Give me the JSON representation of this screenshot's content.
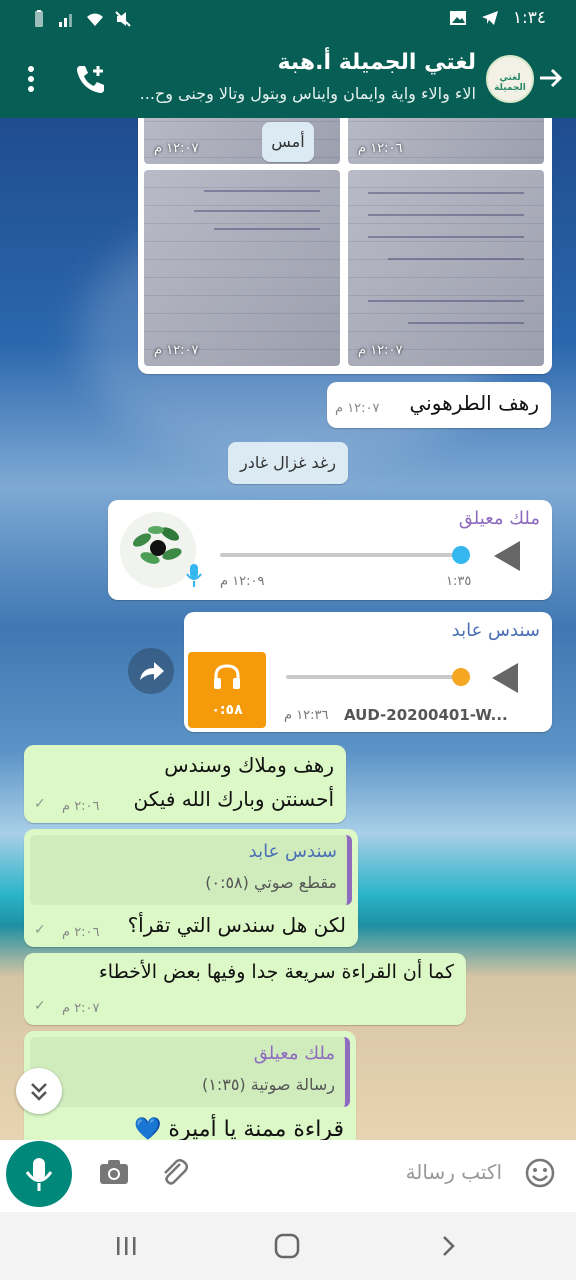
{
  "status_bar": {
    "time": "١:٣٤"
  },
  "header": {
    "title": "لغتي الجميلة أ.هبة",
    "subtitle": "الاء والاء واية وايمان وايناس وبتول وتالا وجنى وح...",
    "avatar_text": "لغتي الجميلة"
  },
  "chat": {
    "photos": [
      {
        "time": "١٢:٠٧ م"
      },
      {
        "time": "١٢:٠٦ م"
      },
      {
        "time": "١٢:٠٧ م"
      },
      {
        "time": "١٢:٠٧ م"
      }
    ],
    "date_chip": "أمس",
    "msg_rahaf": {
      "text": "رهف الطرهوني",
      "time": "١٢:٠٧ م"
    },
    "sys_chip": "رغد غزال غادر",
    "voice_malak": {
      "sender": "ملك معيلق",
      "duration": "١:٣٥",
      "time": "١٢:٠٩ م",
      "progress": 1.0
    },
    "audio_sondos": {
      "sender": "سندس عابد",
      "length": "٠:٥٨",
      "filename": "AUD-20200401-W...",
      "time": "١٢:٣٦ م",
      "progress": 1.0
    },
    "out1": {
      "line1": "رهف وملاك وسندس",
      "line2": "أحسنتن وبارك الله فيكن",
      "time": "٢:٠٦ م"
    },
    "out2": {
      "quote_sender": "سندس عابد",
      "quote_text": "مقطع صوتي (٠:٥٨)",
      "text": "لكن هل سندس التي تقرأ؟",
      "time": "٢:٠٦ م"
    },
    "out3": {
      "text": "كما أن القراءة سريعة جدا وفيها بعض الأخطاء",
      "time": "٢:٠٧ م"
    },
    "out4": {
      "quote_sender": "ملك معيلق",
      "quote_text": "رسالة صوتية (١:٣٥)",
      "text": "قراءة ممنة يا أميرة 💙"
    }
  },
  "input": {
    "placeholder": "اكتب رسالة"
  },
  "colors": {
    "header": "#075e54",
    "outgoing": "#dcf8c6",
    "incoming": "#ffffff",
    "accent": "#00897b",
    "voice_knob": "#34b7f1",
    "audio_knob": "#f5a623"
  }
}
